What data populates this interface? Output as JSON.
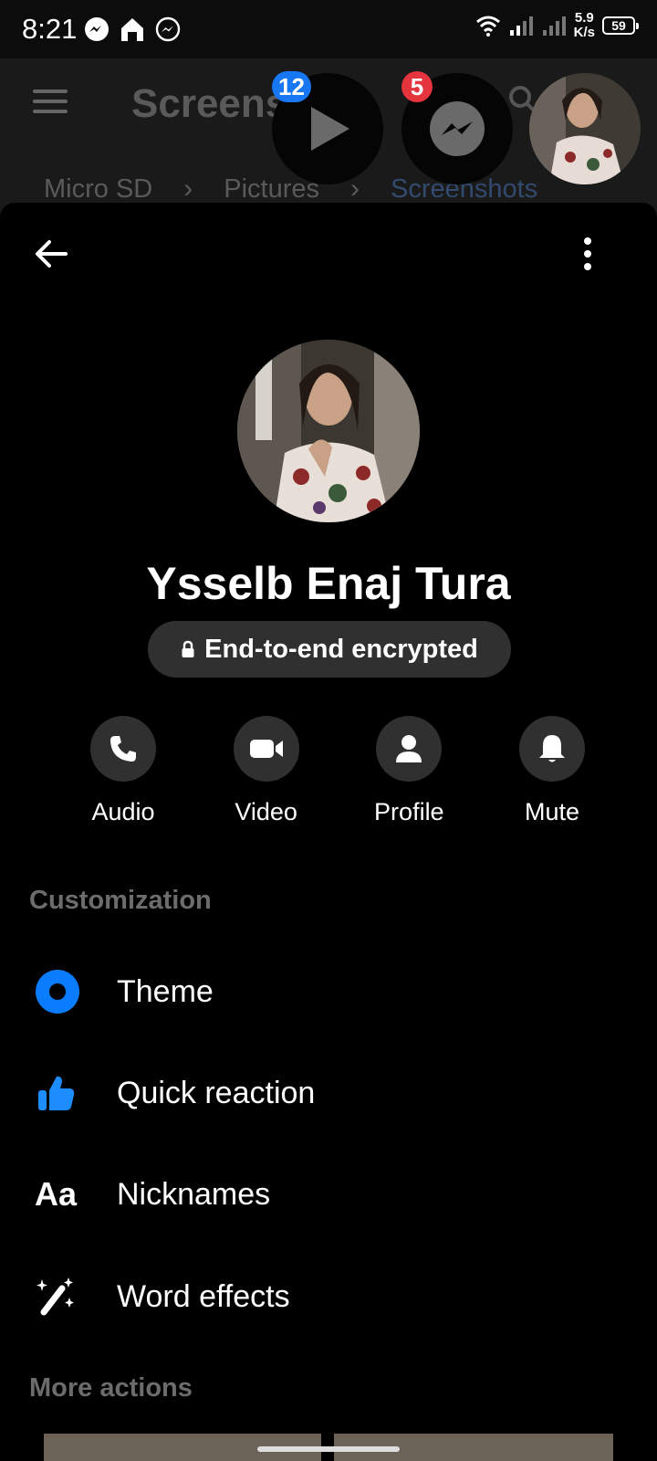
{
  "status_bar": {
    "time": "8:21",
    "net_speed_value": "5.9",
    "net_speed_unit": "K/s",
    "battery": "59"
  },
  "background_app": {
    "title": "Screens",
    "breadcrumbs": [
      "Micro SD",
      "Pictures",
      "Screenshots"
    ]
  },
  "chat_heads": {
    "video_badge": "12",
    "messenger_badge": "5"
  },
  "profile": {
    "name": "Ysselb Enaj Tura",
    "encryption_label": "End-to-end encrypted"
  },
  "actions": [
    {
      "label": "Audio",
      "icon": "phone-icon"
    },
    {
      "label": "Video",
      "icon": "video-camera-icon"
    },
    {
      "label": "Profile",
      "icon": "person-icon"
    },
    {
      "label": "Mute",
      "icon": "bell-icon"
    }
  ],
  "customization": {
    "title": "Customization",
    "items": [
      {
        "label": "Theme",
        "icon": "theme-icon"
      },
      {
        "label": "Quick reaction",
        "icon": "thumbs-up-icon"
      },
      {
        "label": "Nicknames",
        "icon": "text-aa-icon",
        "icon_text": "Aa"
      },
      {
        "label": "Word effects",
        "icon": "magic-wand-icon"
      }
    ]
  },
  "more_actions": {
    "title": "More actions"
  },
  "colors": {
    "accent": "#0a7cff",
    "badge_blue": "#1877f2",
    "badge_red": "#e4343e",
    "pill_bg": "#303030"
  }
}
